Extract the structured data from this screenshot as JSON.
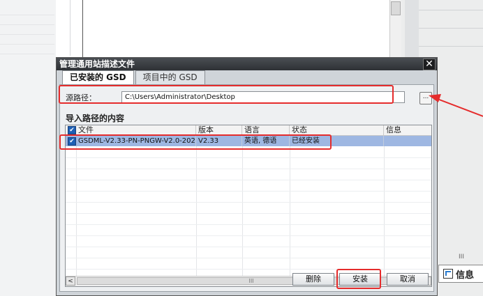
{
  "background": {
    "info_tab_label": "信息",
    "scroll_mark": "III"
  },
  "dialog": {
    "title": "管理通用站描述文件",
    "close_glyph": "✕",
    "tabs": [
      {
        "label": "已安装的 GSD",
        "active": true
      },
      {
        "label": "项目中的 GSD",
        "active": false
      }
    ],
    "source_label": "源路径：",
    "source_value": "C:\\Users\\Administrator\\Desktop",
    "browse_label": "...",
    "section_title": "导入路径的内容",
    "columns": [
      "文件",
      "版本",
      "语言",
      "状态",
      "信息"
    ],
    "rows": [
      {
        "checked": true,
        "file": "GSDML-V2.33-PN-PNGW-V2.0-202...",
        "version": "V2.33",
        "language": "英语, 德语",
        "status": "已经安装",
        "info": ""
      }
    ],
    "scroll_left": "<",
    "scroll_right": ">",
    "scroll_mark": "III",
    "buttons": {
      "delete": "删除",
      "install": "安装",
      "cancel": "取消"
    }
  },
  "colors": {
    "highlight": "#e52c2c",
    "selected_row": "#9eb7e2",
    "titlebar": "#2e3135"
  }
}
